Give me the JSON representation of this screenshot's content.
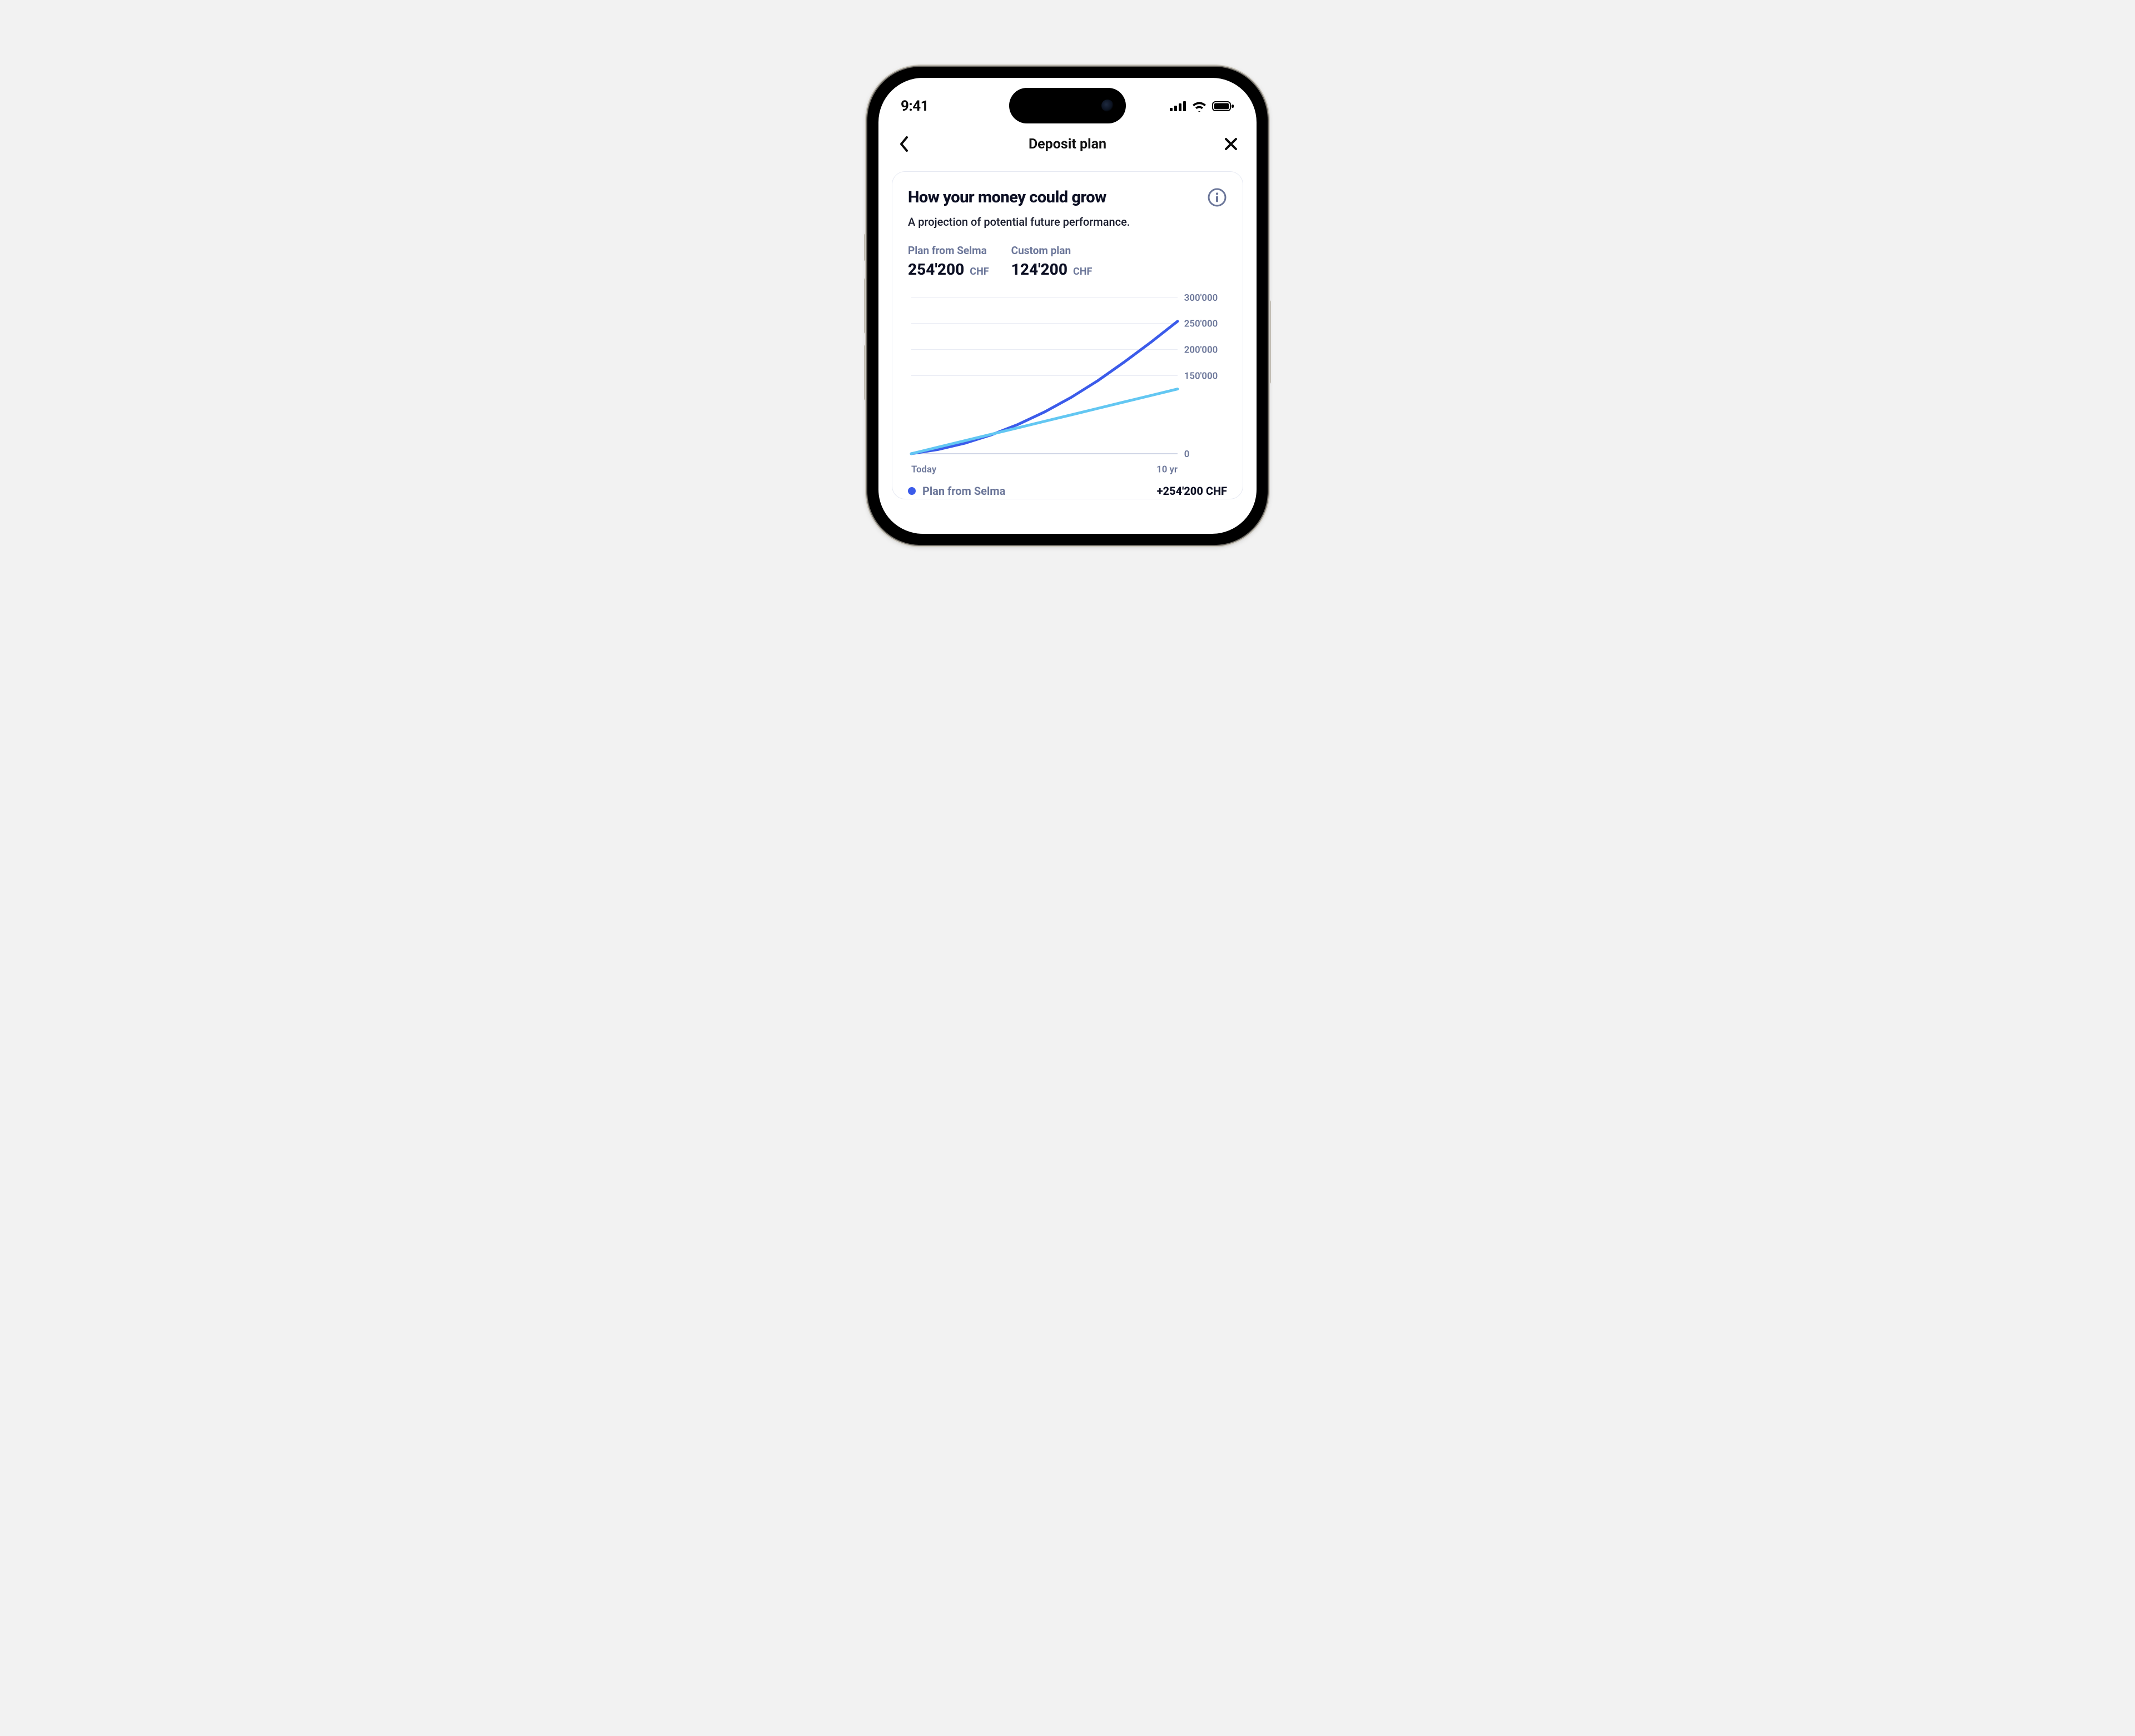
{
  "status": {
    "time": "9:41"
  },
  "nav": {
    "title": "Deposit plan"
  },
  "card": {
    "title": "How your money could grow",
    "subtitle": "A projection of potential future performance."
  },
  "metrics": {
    "series": [
      {
        "label": "Plan from Selma",
        "value": "254'200",
        "currency": "CHF"
      },
      {
        "label": "Custom plan",
        "value": "124'200",
        "currency": "CHF"
      }
    ]
  },
  "chart_data": {
    "type": "line",
    "xlabel": "",
    "ylabel": "",
    "x_ticks": [
      "Today",
      "10 yr"
    ],
    "y_ticks": [
      "0",
      "150'000",
      "200'000",
      "250'000",
      "300'000"
    ],
    "ylim": [
      0,
      300000
    ],
    "series": [
      {
        "name": "Plan from Selma",
        "color": "#3b5bea",
        "x": [
          0,
          1,
          2,
          3,
          4,
          5,
          6,
          7,
          8,
          9,
          10
        ],
        "values": [
          0,
          8000,
          20000,
          36000,
          56000,
          80000,
          108000,
          140000,
          176000,
          214000,
          254200
        ]
      },
      {
        "name": "Custom plan",
        "color": "#63c7f2",
        "x": [
          0,
          1,
          2,
          3,
          4,
          5,
          6,
          7,
          8,
          9,
          10
        ],
        "values": [
          0,
          12420,
          24840,
          37260,
          49680,
          62100,
          74520,
          86940,
          99360,
          111780,
          124200
        ]
      }
    ]
  },
  "legend": {
    "items": [
      {
        "name": "Plan from Selma",
        "value": "+254'200 CHF",
        "color": "#3b5bea"
      }
    ]
  },
  "icons": {
    "back": "chevron-left",
    "close": "x",
    "info": "info"
  }
}
